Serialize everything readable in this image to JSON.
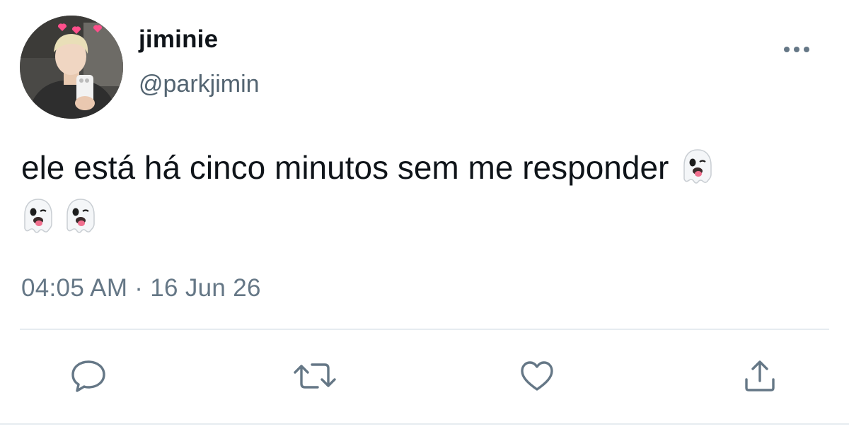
{
  "tweet": {
    "display_name": "jiminie",
    "handle": "@parkjimin",
    "text": "ele está há cinco minutos sem me responder",
    "emoji_icons": [
      "ghost-emoji",
      "ghost-emoji",
      "ghost-emoji"
    ],
    "timestamp": "04:05 AM · 16 Jun 26"
  },
  "actions": {
    "icons": [
      "reply-icon",
      "retweet-icon",
      "like-icon",
      "share-icon"
    ]
  },
  "colors": {
    "text_primary": "#0f1419",
    "text_secondary": "#536471",
    "icon": "#657786",
    "divider": "#e6ecf0"
  }
}
